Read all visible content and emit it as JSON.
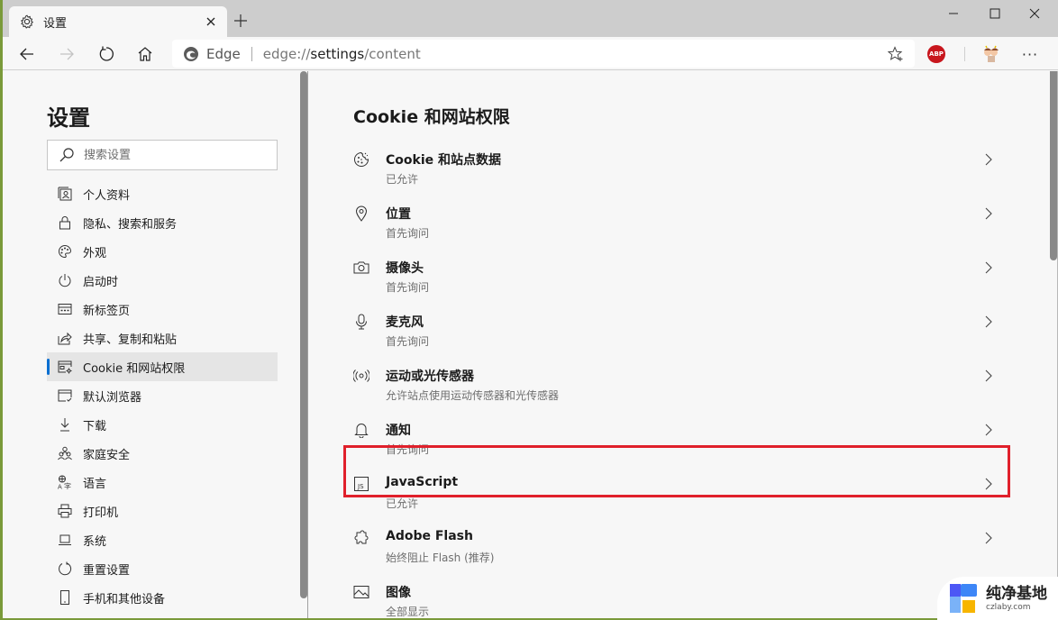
{
  "browser": {
    "tab": {
      "title": "设置",
      "icon": "gear-icon"
    },
    "new_tab_label": "+",
    "window_controls": {
      "minimize": "minimize",
      "maximize": "maximize",
      "close": "close"
    },
    "address": {
      "brand": "Edge",
      "url_prefix": "edge://",
      "url_host": "settings",
      "url_path": "/content"
    },
    "extensions": {
      "adblock_label": "ABP"
    },
    "more_label": "···"
  },
  "sidebar": {
    "title": "设置",
    "search_placeholder": "搜索设置",
    "items": [
      {
        "label": "个人资料",
        "icon": "profile-icon"
      },
      {
        "label": "隐私、搜索和服务",
        "icon": "lock-icon"
      },
      {
        "label": "外观",
        "icon": "palette-icon"
      },
      {
        "label": "启动时",
        "icon": "power-icon"
      },
      {
        "label": "新标签页",
        "icon": "new-tab-page-icon"
      },
      {
        "label": "共享、复制和粘贴",
        "icon": "share-icon"
      },
      {
        "label": "Cookie 和网站权限",
        "icon": "site-permissions-icon",
        "active": true
      },
      {
        "label": "默认浏览器",
        "icon": "default-browser-icon"
      },
      {
        "label": "下载",
        "icon": "download-icon"
      },
      {
        "label": "家庭安全",
        "icon": "family-icon"
      },
      {
        "label": "语言",
        "icon": "language-icon"
      },
      {
        "label": "打印机",
        "icon": "printer-icon"
      },
      {
        "label": "系统",
        "icon": "laptop-icon"
      },
      {
        "label": "重置设置",
        "icon": "reset-icon"
      },
      {
        "label": "手机和其他设备",
        "icon": "phone-icon"
      }
    ]
  },
  "main": {
    "title": "Cookie 和网站权限",
    "rows": [
      {
        "title": "Cookie 和站点数据",
        "subtitle": "已允许",
        "icon": "cookie-icon"
      },
      {
        "title": "位置",
        "subtitle": "首先询问",
        "icon": "location-icon"
      },
      {
        "title": "摄像头",
        "subtitle": "首先询问",
        "icon": "camera-icon"
      },
      {
        "title": "麦克风",
        "subtitle": "首先询问",
        "icon": "microphone-icon"
      },
      {
        "title": "运动或光传感器",
        "subtitle": "允许站点使用运动传感器和光传感器",
        "icon": "sensor-icon"
      },
      {
        "title": "通知",
        "subtitle": "首先询问",
        "icon": "bell-icon"
      },
      {
        "title": "JavaScript",
        "subtitle": "已允许",
        "icon": "javascript-icon"
      },
      {
        "title": "Adobe Flash",
        "subtitle": "始终阻止 Flash (推荐)",
        "icon": "puzzle-icon",
        "highlighted": true
      },
      {
        "title": "图像",
        "subtitle": "全部显示",
        "icon": "image-icon"
      }
    ]
  },
  "watermark": {
    "name": "纯净基地",
    "domain": "czlaby.com"
  },
  "colors": {
    "accent": "#0a6fd1",
    "highlight_border": "#e0202b",
    "abp_red": "#c8161d"
  }
}
